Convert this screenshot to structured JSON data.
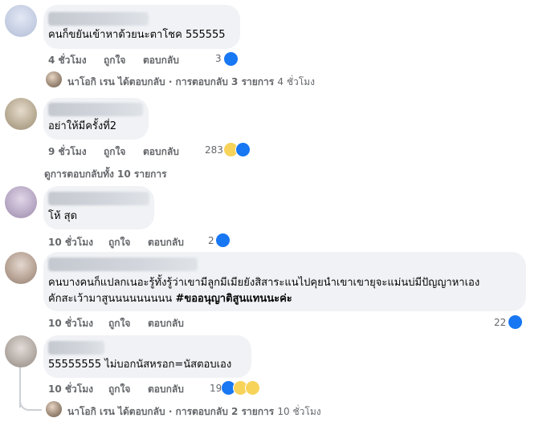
{
  "colors": {
    "bubble": "#f0f2f5",
    "meta": "#65676b",
    "like": "#1877f2"
  },
  "comments": [
    {
      "text": "คนก็ขยันเข้าหาด้วยนะตาโชค 555555",
      "time": "4 ชั่วโมง",
      "like": "ถูกใจ",
      "reply": "ตอบกลับ",
      "count": "3",
      "reactions": [
        "like-icon"
      ]
    },
    {
      "text": "อย่าให้มีครั้งที่2",
      "time": "9 ชั่วโมง",
      "like": "ถูกใจ",
      "reply": "ตอบกลับ",
      "count": "283",
      "reactions": [
        "haha-icon",
        "like-icon"
      ]
    },
    {
      "text": "โห้ สุด",
      "time": "10 ชั่วโมง",
      "like": "ถูกใจ",
      "reply": "ตอบกลับ",
      "count": "2",
      "reactions": [
        "like-icon"
      ]
    },
    {
      "text_line1": "คนบางคนก็แปลกเนอะรู้ทั้งรู้ว่าเขามีลูกมีเมียยังสิสาระแนไปคุยนำเขาเขายุจะแม่นบ่มีปัญญาหาเอง",
      "text_line2": "คักสะเว้ามาสูนนนนนนนนน",
      "hashtag": "#ขออนุญาติสูนแทนนะค่ะ",
      "time": "10 ชั่วโมง",
      "like": "ถูกใจ",
      "reply": "ตอบกลับ",
      "count": "22",
      "reactions": [
        "like-icon"
      ]
    },
    {
      "text": "55555555 ไม่บอกนัสหรอก=นัสตอบเอง",
      "time": "10 ชั่วโมง",
      "like": "ถูกใจ",
      "reply": "ตอบกลับ",
      "count": "19",
      "reactions": [
        "like-icon",
        "haha-icon",
        "care-icon"
      ]
    }
  ],
  "reply_summaries": [
    {
      "text": "นาโอกิ เรน ได้ตอบกลับ · การตอบกลับ 3 รายการ",
      "time": "4 ชั่วโมง"
    },
    {
      "text": "นาโอกิ เรน ได้ตอบกลับ · การตอบกลับ 2 รายการ",
      "time": "10 ชั่วโมง"
    }
  ],
  "view_all_replies": "ดูการตอบกลับทั้ง 10 รายการ"
}
